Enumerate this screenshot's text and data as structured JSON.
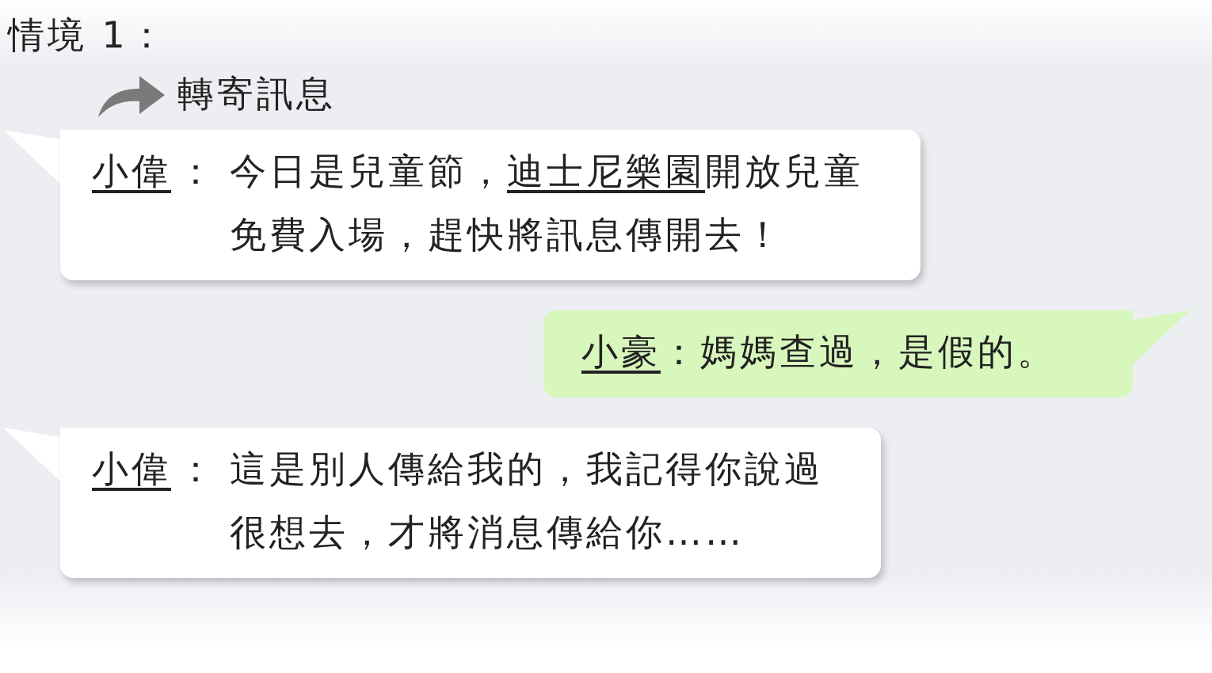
{
  "scenario_title": "情境 1：",
  "forward_label": "轉寄訊息",
  "messages": [
    {
      "kind": "received",
      "sender": "小偉",
      "colon": "：",
      "lines": [
        [
          {
            "text": "今日是兒童節，",
            "underline": false
          },
          {
            "text": "迪士尼樂園",
            "underline": true
          },
          {
            "text": "開放兒童",
            "underline": false
          }
        ],
        [
          {
            "text": "免費入場，趕快將訊息傳開去！",
            "underline": false
          }
        ]
      ]
    },
    {
      "kind": "sent",
      "sender": "小豪",
      "colon": "：",
      "lines": [
        [
          {
            "text": "媽媽查過，是假的。",
            "underline": false
          }
        ]
      ]
    },
    {
      "kind": "received",
      "sender": "小偉",
      "colon": "：",
      "lines": [
        [
          {
            "text": "這是別人傳給我的，我記得你說過",
            "underline": false
          }
        ],
        [
          {
            "text": "很想去，才將消息傳給你……",
            "underline": false
          }
        ]
      ]
    }
  ]
}
